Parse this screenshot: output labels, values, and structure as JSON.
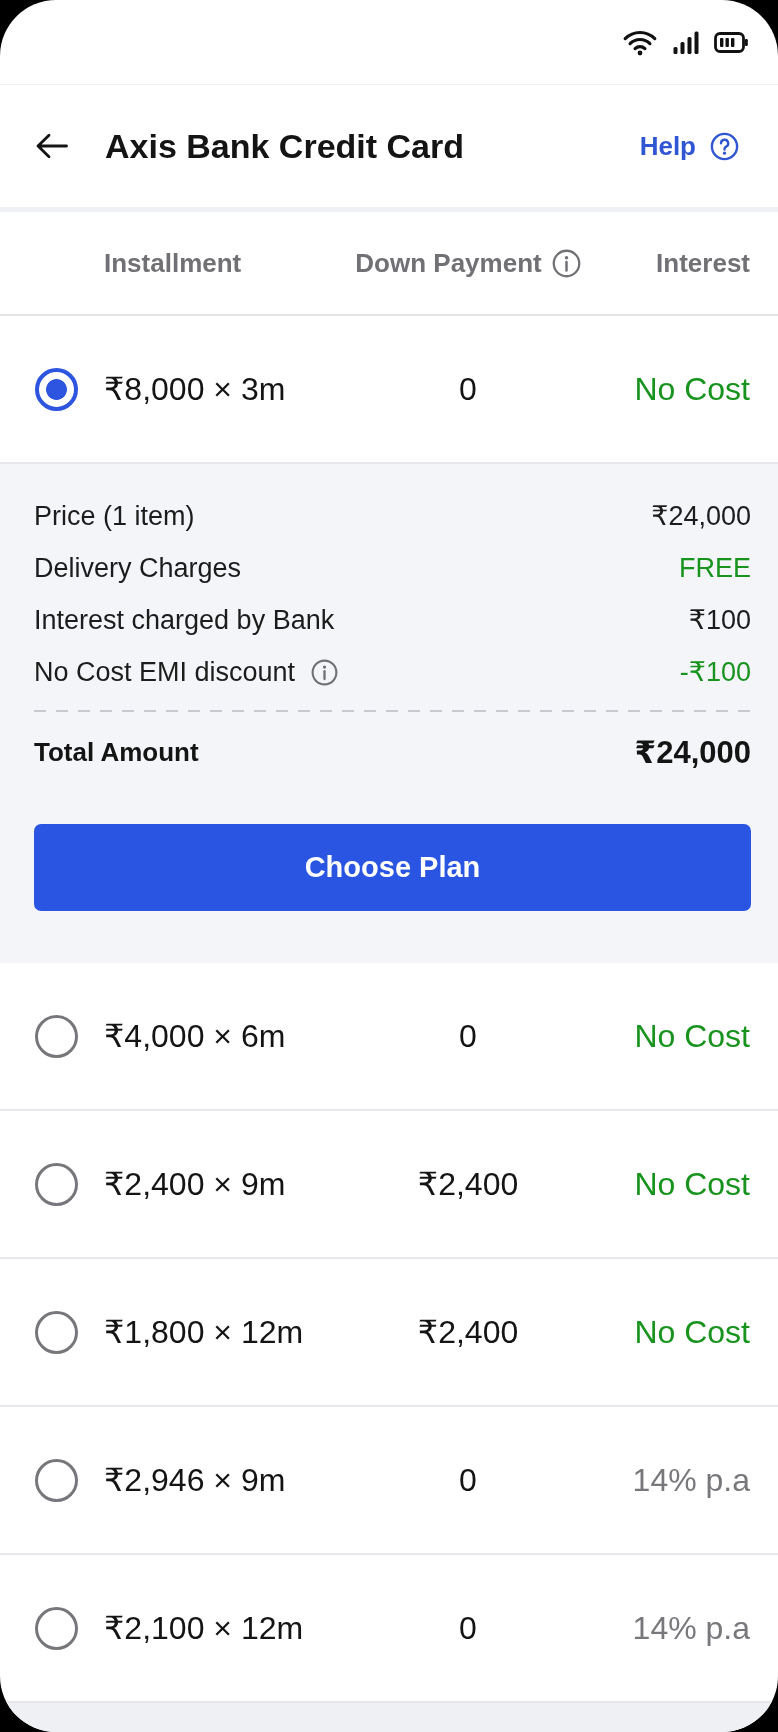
{
  "header": {
    "title": "Axis Bank Credit Card",
    "help_label": "Help"
  },
  "table": {
    "columns": [
      {
        "label": "Installment",
        "info": false
      },
      {
        "label": "Down Payment",
        "info": true
      },
      {
        "label": "Interest",
        "info": false
      }
    ],
    "rows": [
      {
        "installment": "₹8,000 × 3m",
        "down_payment": "0",
        "interest": "No Cost",
        "kind": "no_cost",
        "selected": true,
        "details": {
          "lines": [
            {
              "label": "Price (1 item)",
              "value": "₹24,000",
              "kind": "charge",
              "info": false
            },
            {
              "label": "Delivery Charges",
              "value": "FREE",
              "kind": "saving",
              "info": false
            },
            {
              "label": "Interest charged by Bank",
              "value": "₹100",
              "kind": "charge",
              "info": false
            },
            {
              "label": "No Cost EMI discount",
              "value": "-₹100",
              "kind": "saving",
              "info": true
            }
          ],
          "total": {
            "label": "Total Amount",
            "value": "₹24,000"
          },
          "button": "Choose Plan"
        }
      },
      {
        "installment": "₹4,000 × 6m",
        "down_payment": "0",
        "interest": "No Cost",
        "kind": "no_cost",
        "selected": false
      },
      {
        "installment": "₹2,400 × 9m",
        "down_payment": "₹2,400",
        "interest": "No Cost",
        "kind": "no_cost",
        "selected": false
      },
      {
        "installment": "₹1,800 × 12m",
        "down_payment": "₹2,400",
        "interest": "No Cost",
        "kind": "no_cost",
        "selected": false
      },
      {
        "installment": "₹2,946 × 9m",
        "down_payment": "0",
        "interest": "14% p.a",
        "kind": "rate",
        "selected": false
      },
      {
        "installment": "₹2,100 × 12m",
        "down_payment": "0",
        "interest": "14% p.a",
        "kind": "rate",
        "selected": false
      }
    ]
  }
}
